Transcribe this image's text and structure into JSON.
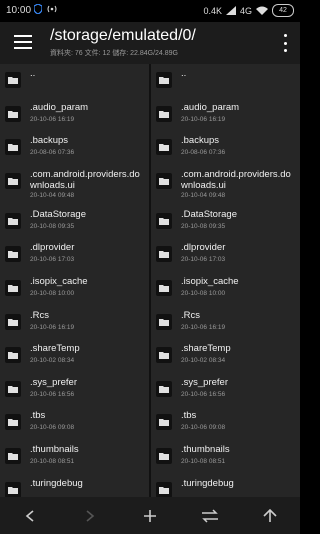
{
  "status_bar": {
    "time": "10:00",
    "network_speed": "0.4K",
    "network_type": "4G",
    "battery": "42"
  },
  "app_bar": {
    "path": "/storage/emulated/0/",
    "summary": "資料夾: 76  文件: 12  儲存: 22.84G/24.89G"
  },
  "left_pane": {
    "items": [
      {
        "name": "..",
        "date": ""
      },
      {
        "name": ".audio_param",
        "date": "20-10-06 16:19"
      },
      {
        "name": ".backups",
        "date": "20-08-06 07:36"
      },
      {
        "name": ".com.android.providers.downloads.ui",
        "date": "20-10-04 09:48"
      },
      {
        "name": ".DataStorage",
        "date": "20-10-08 09:35"
      },
      {
        "name": ".dlprovider",
        "date": "20-10-06 17:03"
      },
      {
        "name": ".isopix_cache",
        "date": "20-10-08 10:00"
      },
      {
        "name": ".Rcs",
        "date": "20-10-06 16:19"
      },
      {
        "name": ".shareTemp",
        "date": "20-10-02 08:34"
      },
      {
        "name": ".sys_prefer",
        "date": "20-10-06 16:56"
      },
      {
        "name": ".tbs",
        "date": "20-10-06 09:08"
      },
      {
        "name": ".thumbnails",
        "date": "20-10-08 08:51"
      },
      {
        "name": ".turingdebug",
        "date": ""
      }
    ]
  },
  "right_pane": {
    "items": [
      {
        "name": "..",
        "date": ""
      },
      {
        "name": ".audio_param",
        "date": "20-10-06 16:19"
      },
      {
        "name": ".backups",
        "date": "20-08-06 07:36"
      },
      {
        "name": ".com.android.providers.downloads.ui",
        "date": "20-10-04 09:48"
      },
      {
        "name": ".DataStorage",
        "date": "20-10-08 09:35"
      },
      {
        "name": ".dlprovider",
        "date": "20-10-06 17:03"
      },
      {
        "name": ".isopix_cache",
        "date": "20-10-08 10:00"
      },
      {
        "name": ".Rcs",
        "date": "20-10-06 16:19"
      },
      {
        "name": ".shareTemp",
        "date": "20-10-02 08:34"
      },
      {
        "name": ".sys_prefer",
        "date": "20-10-06 16:56"
      },
      {
        "name": ".tbs",
        "date": "20-10-06 09:08"
      },
      {
        "name": ".thumbnails",
        "date": "20-10-08 08:51"
      },
      {
        "name": ".turingdebug",
        "date": ""
      }
    ]
  },
  "bottom_bar": {
    "icons": [
      "back-icon",
      "forward-icon",
      "add-icon",
      "swap-icon",
      "up-icon"
    ]
  },
  "colors": {
    "background": "#000000",
    "appbar": "#1c1c1c",
    "pane": "#262626",
    "secondary_text": "#9a9a9a"
  }
}
